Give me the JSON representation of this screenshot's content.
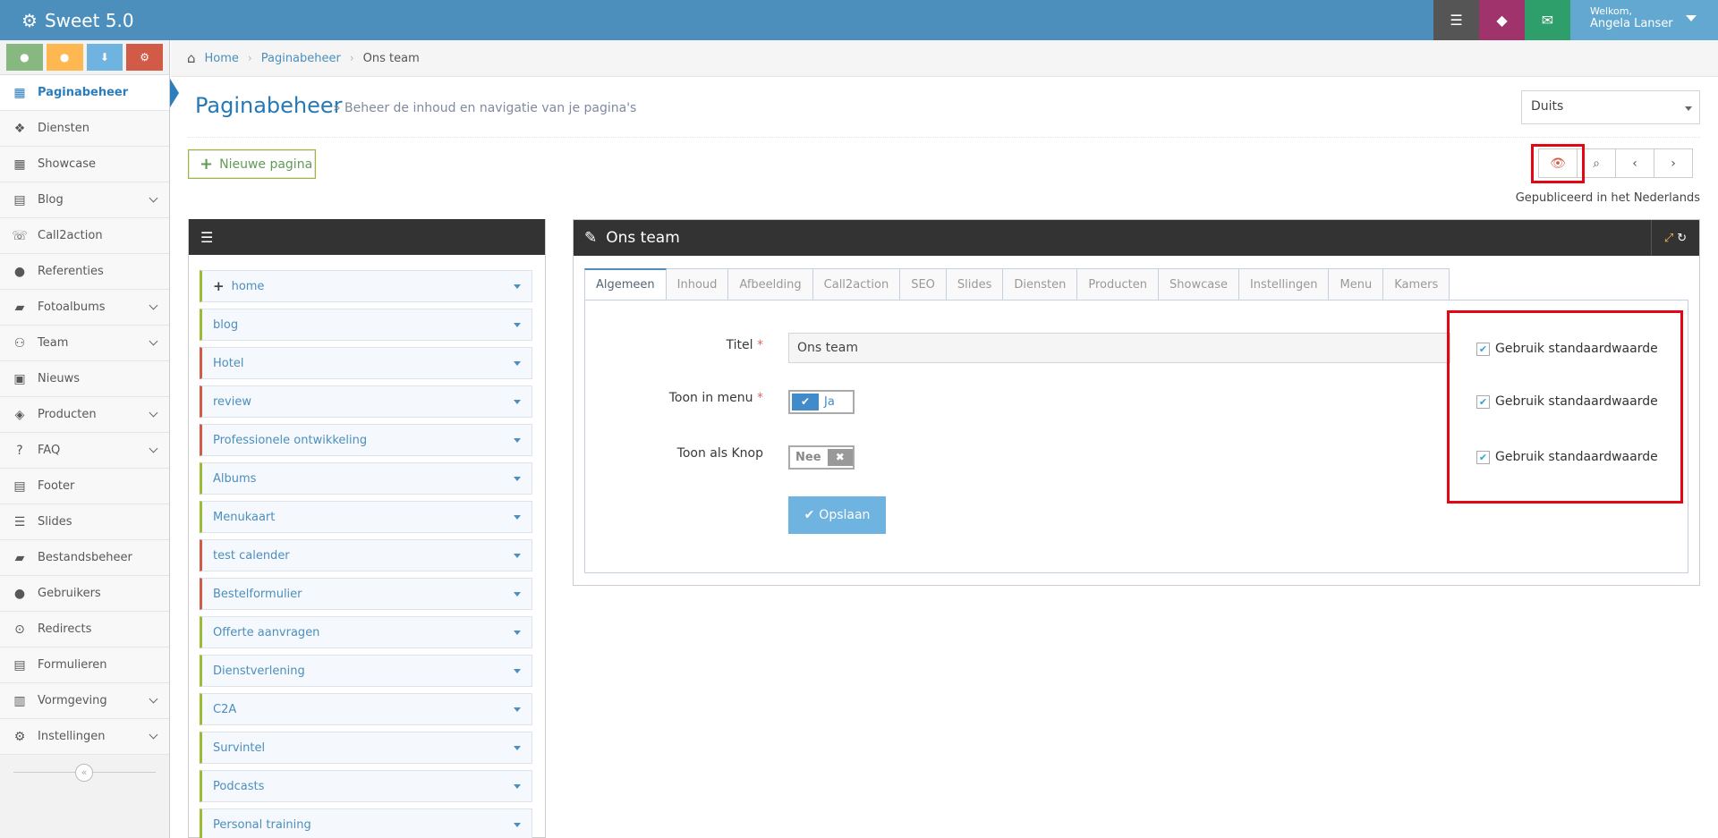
{
  "app": {
    "title": "Sweet 5.0"
  },
  "user": {
    "greeting": "Welkom,",
    "name": "Angela Lanser"
  },
  "sidebar": {
    "items": [
      {
        "label": "Paginabeheer",
        "icon": "table-icon",
        "glyph": "▦",
        "active": true,
        "has_sub": false
      },
      {
        "label": "Diensten",
        "icon": "cubes-icon",
        "glyph": "❖",
        "has_sub": false
      },
      {
        "label": "Showcase",
        "icon": "grid-icon",
        "glyph": "▦",
        "has_sub": false
      },
      {
        "label": "Blog",
        "icon": "file-text-icon",
        "glyph": "▤",
        "has_sub": true
      },
      {
        "label": "Call2action",
        "icon": "phone-icon",
        "glyph": "☏",
        "has_sub": false
      },
      {
        "label": "Referenties",
        "icon": "comments-icon",
        "glyph": "●",
        "has_sub": false
      },
      {
        "label": "Fotoalbums",
        "icon": "book-icon",
        "glyph": "▰",
        "has_sub": true
      },
      {
        "label": "Team",
        "icon": "users-icon",
        "glyph": "⚇",
        "has_sub": true
      },
      {
        "label": "Nieuws",
        "icon": "newspaper-icon",
        "glyph": "▣",
        "has_sub": false
      },
      {
        "label": "Producten",
        "icon": "tags-icon",
        "glyph": "◈",
        "has_sub": true
      },
      {
        "label": "FAQ",
        "icon": "question-icon",
        "glyph": "?",
        "has_sub": true
      },
      {
        "label": "Footer",
        "icon": "list-alt-icon",
        "glyph": "▤",
        "has_sub": false
      },
      {
        "label": "Slides",
        "icon": "sliders-icon",
        "glyph": "☰",
        "has_sub": false
      },
      {
        "label": "Bestandsbeheer",
        "icon": "folder-open-icon",
        "glyph": "▰",
        "has_sub": false
      },
      {
        "label": "Gebruikers",
        "icon": "user-icon",
        "glyph": "●",
        "has_sub": false
      },
      {
        "label": "Redirects",
        "icon": "arrow-circle-icon",
        "glyph": "⊙",
        "has_sub": false
      },
      {
        "label": "Formulieren",
        "icon": "form-icon",
        "glyph": "▤",
        "has_sub": false
      },
      {
        "label": "Vormgeving",
        "icon": "layout-icon",
        "glyph": "▥",
        "has_sub": true
      },
      {
        "label": "Instellingen",
        "icon": "cog-icon",
        "glyph": "⚙",
        "has_sub": true
      }
    ]
  },
  "breadcrumb": {
    "home": "Home",
    "section": "Paginabeheer",
    "current": "Ons team"
  },
  "header": {
    "title": "Paginabeheer",
    "subtitle": "» Beheer de inhoud en navigatie van je pagina's",
    "language": "Duits"
  },
  "toolbar": {
    "new_page": "Nieuwe pagina",
    "published": "Gepubliceerd in het Nederlands"
  },
  "tree": {
    "items": [
      {
        "label": "home",
        "border": "#9abc32",
        "plus": true
      },
      {
        "label": "blog",
        "border": "#9abc32"
      },
      {
        "label": "Hotel",
        "border": "#d15b47"
      },
      {
        "label": "review",
        "border": "#d15b47"
      },
      {
        "label": "Professionele ontwikkeling",
        "border": "#d15b47"
      },
      {
        "label": "Albums",
        "border": "#9abc32"
      },
      {
        "label": "Menukaart",
        "border": "#9abc32"
      },
      {
        "label": "test calender",
        "border": "#d15b47"
      },
      {
        "label": "Bestelformulier",
        "border": "#d15b47"
      },
      {
        "label": "Offerte aanvragen",
        "border": "#9abc32"
      },
      {
        "label": "Dienstverlening",
        "border": "#9abc32"
      },
      {
        "label": "C2A",
        "border": "#9abc32"
      },
      {
        "label": "Survintel",
        "border": "#9abc32"
      },
      {
        "label": "Podcasts",
        "border": "#9abc32"
      },
      {
        "label": "Personal training",
        "border": "#9abc32"
      }
    ]
  },
  "editor": {
    "title": "Ons team",
    "tabs": [
      "Algemeen",
      "Inhoud",
      "Afbeelding",
      "Call2action",
      "SEO",
      "Slides",
      "Diensten",
      "Producten",
      "Showcase",
      "Instellingen",
      "Menu",
      "Kamers"
    ],
    "active_tab": "Algemeen",
    "fields": {
      "titel_label": "Titel",
      "titel_value": "Ons team",
      "menu_label": "Toon in menu",
      "menu_value": "Ja",
      "knop_label": "Toon als Knop",
      "knop_value": "Nee",
      "required_mark": "*"
    },
    "default_checkbox": "Gebruik standaardwaarde",
    "save": "Opslaan"
  }
}
